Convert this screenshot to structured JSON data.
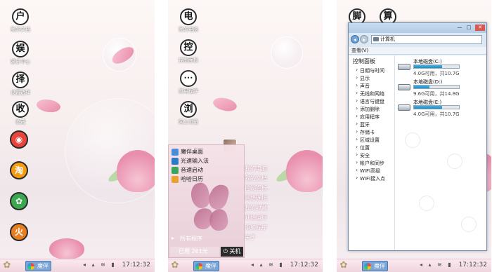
{
  "panel1": {
    "desktop_icons": [
      {
        "glyph": "户",
        "label": "我的文档"
      },
      {
        "glyph": "娱",
        "label": "娱乐中心"
      },
      {
        "glyph": "择",
        "label": "设置选择"
      },
      {
        "glyph": "收",
        "label": "收藏"
      }
    ],
    "app_icons": [
      {
        "glyph": "◉",
        "color": "#e8453c"
      },
      {
        "glyph": "淘",
        "color": "#f39c12"
      },
      {
        "glyph": "✿",
        "color": "#3aa84f"
      },
      {
        "glyph": "火",
        "color": "#e67e22"
      }
    ]
  },
  "panel2": {
    "desktop_icons": [
      {
        "glyph": "电",
        "label": "我的电脑"
      },
      {
        "glyph": "控",
        "label": "控制面板"
      },
      {
        "glyph": "⋯",
        "label": "应用程序"
      },
      {
        "glyph": "浏",
        "label": "网上浏览"
      }
    ],
    "start_menu": {
      "items": [
        {
          "label": "魔伴桌面",
          "color": "#4a8fd6"
        },
        {
          "label": "光速输入法",
          "color": "#2f7ac7"
        },
        {
          "label": "音速启动",
          "color": "#3ba55c"
        },
        {
          "label": "哈哈日历",
          "color": "#e8a12c"
        }
      ],
      "all_programs": "所有程序",
      "search_text": "已用 261元",
      "power_label": "关机",
      "right_items": [
        "我的电脑",
        "我的文档",
        "控制面板",
        "网络连接",
        "我的收藏",
        "开始运行",
        "添加程序",
        "关于"
      ]
    }
  },
  "panel3": {
    "desktop_icons": [
      {
        "glyph": "脚",
        "label": ""
      },
      {
        "glyph": "算",
        "label": ""
      }
    ],
    "explorer": {
      "address": "计算机",
      "menu_label": "查看(V)",
      "sidebar_title": "控制面板",
      "sidebar_items": [
        "日期与时间",
        "显示",
        "声音",
        "无线和网络",
        "语言与键盘",
        "添加删除",
        "应用程序",
        "蓝牙",
        "存储卡",
        "区域设置",
        "位置",
        "安全",
        "帐户和同步",
        "WIFI高级",
        "WIFI接入点"
      ],
      "drives": [
        {
          "name": "本地磁盘(C:)",
          "info": "4.0G可用，共10.7G",
          "used_fraction": 0.63
        },
        {
          "name": "本地磁盘(D:)",
          "info": "9.6G可用，共14.8G",
          "used_fraction": 0.35
        },
        {
          "name": "本地磁盘(E:)",
          "info": "4.0G可用，共10.7G",
          "used_fraction": 0.63
        }
      ],
      "window_buttons": [
        "—",
        "□",
        "✕"
      ]
    }
  },
  "taskbar": {
    "app_label": "魔伴",
    "tray": "◂ ▴ ≋ ▮",
    "clock": "17:12:32"
  }
}
